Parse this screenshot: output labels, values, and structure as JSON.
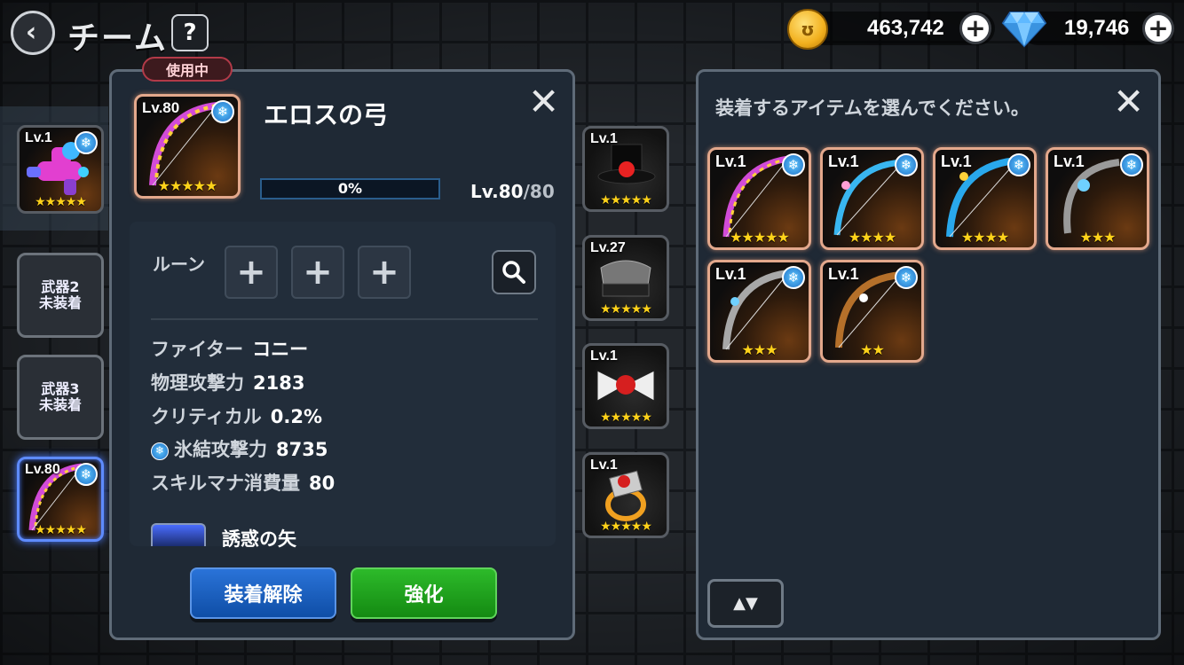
{
  "header": {
    "back_icon": "chevron-left-icon",
    "title": "チーム",
    "help": "?"
  },
  "currency": {
    "coins": "463,742",
    "gems": "19,746",
    "plus": "+"
  },
  "left_slots": [
    {
      "level": "Lv.1",
      "stars": "★★★★★",
      "item": "water-gun"
    },
    {
      "empty_label_line1": "武器2",
      "empty_label_line2": "未装着"
    },
    {
      "empty_label_line1": "武器3",
      "empty_label_line2": "未装着"
    },
    {
      "level": "Lv.80",
      "stars": "★★★★★",
      "item": "eros-bow"
    }
  ],
  "detail": {
    "badge": "使用中",
    "item_level": "Lv.80",
    "item_stars": "★★★★★",
    "name": "エロスの弓",
    "progress_label": "0%",
    "progress_value": 0,
    "level_current": "Lv.80",
    "level_max": "/80",
    "rune_label": "ルーン",
    "rune_plus": "+",
    "stats": [
      {
        "label": "ファイター",
        "value": "コニー"
      },
      {
        "label": "物理攻撃力",
        "value": "2183"
      },
      {
        "label": "クリティカル",
        "value": "0.2%"
      },
      {
        "label": "氷結攻撃力",
        "value": "8735"
      },
      {
        "label": "スキルマナ消費量",
        "value": "80"
      }
    ],
    "skill_name": "誘惑の矢",
    "unequip_button": "装着解除",
    "upgrade_button": "強化"
  },
  "accessories": [
    {
      "level": "Lv.1",
      "stars": "★★★★★"
    },
    {
      "level": "Lv.27",
      "stars": "★★★★★"
    },
    {
      "level": "Lv.1",
      "stars": "★★★★★"
    },
    {
      "level": "Lv.1",
      "stars": "★★★★★"
    }
  ],
  "picker": {
    "title": "装着するアイテムを選んでください。",
    "items": [
      {
        "level": "Lv.1",
        "stars": "★★★★★"
      },
      {
        "level": "Lv.1",
        "stars": "★★★★"
      },
      {
        "level": "Lv.1",
        "stars": "★★★★"
      },
      {
        "level": "Lv.1",
        "stars": "★★★"
      },
      {
        "level": "Lv.1",
        "stars": "★★★"
      },
      {
        "level": "Lv.1",
        "stars": "★★"
      }
    ],
    "sort_label": "▲▼"
  },
  "colors": {
    "panel": "#1f2935",
    "panel_border": "#5f6b78",
    "blue_button": "#1f63c0",
    "green_button": "#22a31f",
    "star": "#ffd21a",
    "frost": "#3aa0ec"
  },
  "close_symbol": "✕",
  "frost_symbol": "❄"
}
